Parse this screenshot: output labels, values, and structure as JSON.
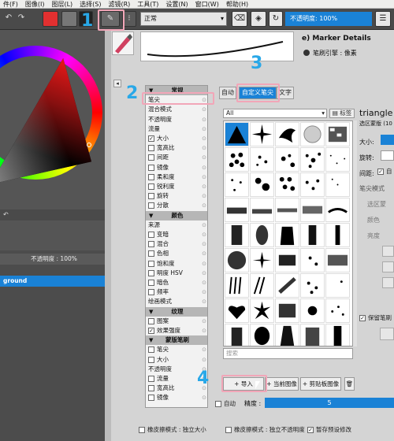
{
  "menubar": {
    "items": [
      "件(F)",
      "图像(I)",
      "图层(L)",
      "选择(S)",
      "滤镜(R)",
      "工具(T)",
      "设置(N)",
      "窗口(W)",
      "帮助(H)"
    ]
  },
  "toolbar": {
    "blend_mode": "正常",
    "opacity_label": "不透明度:",
    "opacity_value": "100%"
  },
  "preset": {
    "name": "e) Marker Details",
    "engine_label": "笔刷引擎 : 像素"
  },
  "tabs": {
    "auto": "自动",
    "custom": "自定义笔尖",
    "text": "文字"
  },
  "filter": {
    "value": "All",
    "tag_button": "标签"
  },
  "tip_name": "triangle",
  "tip_sub": "选区蒙版 (10",
  "right_fields": {
    "size": "大小:",
    "rotation": "旋转:",
    "spacing": "间距:",
    "auto": "自",
    "tip_mode": "笔尖模式",
    "sel_mask": "选区蒙",
    "color": "颜色",
    "lightness": "亮度",
    "keep_brush": "保留笔刷"
  },
  "options_list": [
    {
      "type": "section",
      "label": "常规"
    },
    {
      "type": "item",
      "label": "笔尖"
    },
    {
      "type": "item",
      "label": "混合模式"
    },
    {
      "type": "item",
      "label": "不透明度"
    },
    {
      "type": "item",
      "label": "流量"
    },
    {
      "type": "check",
      "label": "大小",
      "checked": true
    },
    {
      "type": "check",
      "label": "宽高比",
      "checked": false
    },
    {
      "type": "check",
      "label": "间距",
      "checked": false
    },
    {
      "type": "check",
      "label": "镜像",
      "checked": false
    },
    {
      "type": "check",
      "label": "柔和度",
      "checked": false
    },
    {
      "type": "check",
      "label": "锐利度",
      "checked": false
    },
    {
      "type": "check",
      "label": "旋转",
      "checked": false
    },
    {
      "type": "check",
      "label": "分散",
      "checked": false
    },
    {
      "type": "section",
      "label": "颜色"
    },
    {
      "type": "item",
      "label": "来源"
    },
    {
      "type": "check",
      "label": "变暗",
      "checked": false
    },
    {
      "type": "check",
      "label": "混合",
      "checked": false
    },
    {
      "type": "check",
      "label": "色相",
      "checked": false
    },
    {
      "type": "check",
      "label": "饱和度",
      "checked": false
    },
    {
      "type": "check",
      "label": "明度 HSV",
      "checked": false
    },
    {
      "type": "check",
      "label": "暗色",
      "checked": false
    },
    {
      "type": "check",
      "label": "频率",
      "checked": false
    },
    {
      "type": "item",
      "label": "绘画模式"
    },
    {
      "type": "section",
      "label": "纹理"
    },
    {
      "type": "check",
      "label": "图案",
      "checked": false
    },
    {
      "type": "check",
      "label": "效果强度",
      "checked": true
    },
    {
      "type": "section",
      "label": "蒙版笔刷"
    },
    {
      "type": "check",
      "label": "笔尖",
      "checked": false
    },
    {
      "type": "check",
      "label": "大小",
      "checked": false
    },
    {
      "type": "item",
      "label": "不透明度"
    },
    {
      "type": "check",
      "label": "流量",
      "checked": false
    },
    {
      "type": "check",
      "label": "宽高比",
      "checked": false
    },
    {
      "type": "check",
      "label": "镜像",
      "checked": false
    }
  ],
  "left_dock": {
    "opacity_label": "不透明度 : 100%",
    "layer": "ground"
  },
  "search_placeholder": "搜索",
  "buttons": {
    "import": "+ 导入",
    "current_image": "+ 当前图像",
    "clipboard_image": "+ 剪贴板图像"
  },
  "bottom": {
    "auto": "自动",
    "precision_label": "精度 :",
    "precision_value": "5",
    "eraser_size": "橡皮擦模式 : 独立大小",
    "eraser_opacity": "橡皮擦模式 : 独立不透明度",
    "save_preset": "暂存预设修改"
  },
  "annotations": {
    "one": "1",
    "two": "2",
    "three": "3",
    "four": "4"
  },
  "colors": {
    "accent": "#1a82d6",
    "annotation": "#29a8e8",
    "highlight": "#f2a6b8"
  }
}
